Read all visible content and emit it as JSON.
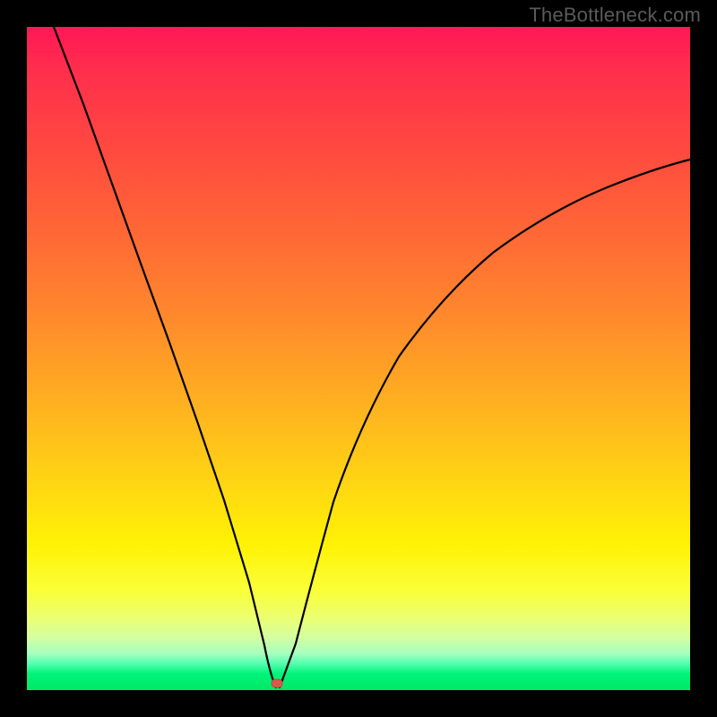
{
  "watermark": "TheBottleneck.com",
  "chart_data": {
    "type": "line",
    "title": "",
    "xlabel": "",
    "ylabel": "",
    "xlim": [
      0,
      100
    ],
    "ylim": [
      0,
      100
    ],
    "series": [
      {
        "name": "left-branch",
        "x": [
          4,
          8,
          12,
          16,
          20,
          24,
          28,
          32,
          35,
          37
        ],
        "y": [
          100,
          88,
          76,
          64,
          52,
          40,
          28,
          15,
          5,
          0
        ]
      },
      {
        "name": "right-branch",
        "x": [
          38,
          40,
          43,
          47,
          52,
          58,
          65,
          73,
          82,
          91,
          100
        ],
        "y": [
          0,
          6,
          16,
          28,
          40,
          50,
          58,
          64,
          69,
          72.5,
          75
        ]
      }
    ],
    "marker": {
      "x": 37.5,
      "y": 0.7,
      "color": "#d85a4a"
    },
    "background_gradient": {
      "top": "#ff1756",
      "mid": "#ffd314",
      "bottom": "#00e765"
    }
  }
}
